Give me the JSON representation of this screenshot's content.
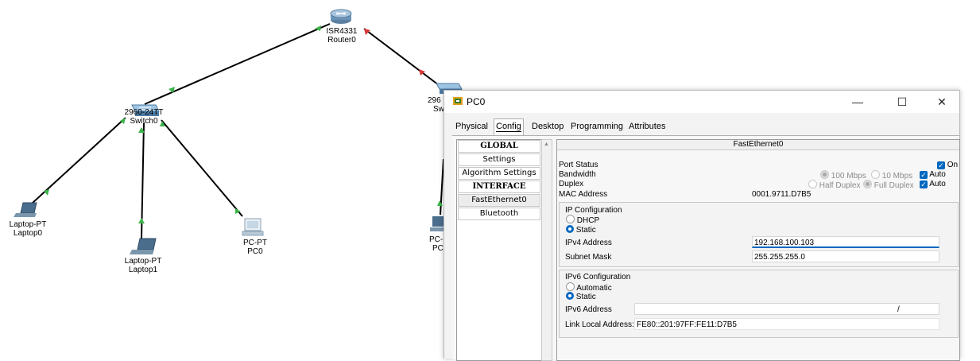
{
  "topology": {
    "devices": [
      {
        "id": "router0",
        "type": "ISR4331",
        "name": "Router0"
      },
      {
        "id": "switch0",
        "type": "2960-24TT",
        "name": "Switch0"
      },
      {
        "id": "switch1",
        "type": "296",
        "name": "Sw"
      },
      {
        "id": "laptop0",
        "type": "Laptop-PT",
        "name": "Laptop0"
      },
      {
        "id": "laptop1",
        "type": "Laptop-PT",
        "name": "Laptop1"
      },
      {
        "id": "pc0",
        "type": "PC-PT",
        "name": "PC0"
      },
      {
        "id": "pc1",
        "type": "PC-",
        "name": "PC"
      }
    ],
    "link_colors": {
      "up": "#3cb44b",
      "down": "#d93636"
    }
  },
  "window": {
    "title": "PC0",
    "controls": {
      "minimize": "—",
      "maximize": "☐",
      "close": "✕"
    },
    "tabs": [
      "Physical",
      "Config",
      "Desktop",
      "Programming",
      "Attributes"
    ],
    "active_tab": "Config"
  },
  "config": {
    "left_list": [
      {
        "label": "GLOBAL",
        "header": true
      },
      {
        "label": "Settings",
        "header": false
      },
      {
        "label": "Algorithm Settings",
        "header": false
      },
      {
        "label": "INTERFACE",
        "header": true
      },
      {
        "label": "FastEthernet0",
        "header": false
      },
      {
        "label": "Bluetooth",
        "header": false
      }
    ],
    "interface_title": "FastEthernet0",
    "port_status_label": "Port Status",
    "port_status_on": "On",
    "bandwidth_label": "Bandwidth",
    "bw_100": "100 Mbps",
    "bw_10": "10 Mbps",
    "bw_auto": "Auto",
    "duplex_label": "Duplex",
    "duplex_half": "Half Duplex",
    "duplex_full": "Full Duplex",
    "duplex_auto": "Auto",
    "mac_label": "MAC Address",
    "mac_value": "0001.9711.D7B5",
    "ip_config": {
      "title": "IP Configuration",
      "dhcp": "DHCP",
      "static": "Static",
      "mode": "Static",
      "ipv4_label": "IPv4 Address",
      "ipv4_value": "192.168.100.103",
      "mask_label": "Subnet Mask",
      "mask_value": "255.255.255.0"
    },
    "ipv6_config": {
      "title": "IPv6 Configuration",
      "automatic": "Automatic",
      "static": "Static",
      "mode": "Static",
      "ipv6_label": "IPv6 Address",
      "ipv6_value": "",
      "prefix_sep": "/",
      "link_local_label": "Link Local Address:",
      "link_local_value": "FE80::201:97FF:FE11:D7B5"
    }
  },
  "colors": {
    "accent": "#0067c0"
  }
}
